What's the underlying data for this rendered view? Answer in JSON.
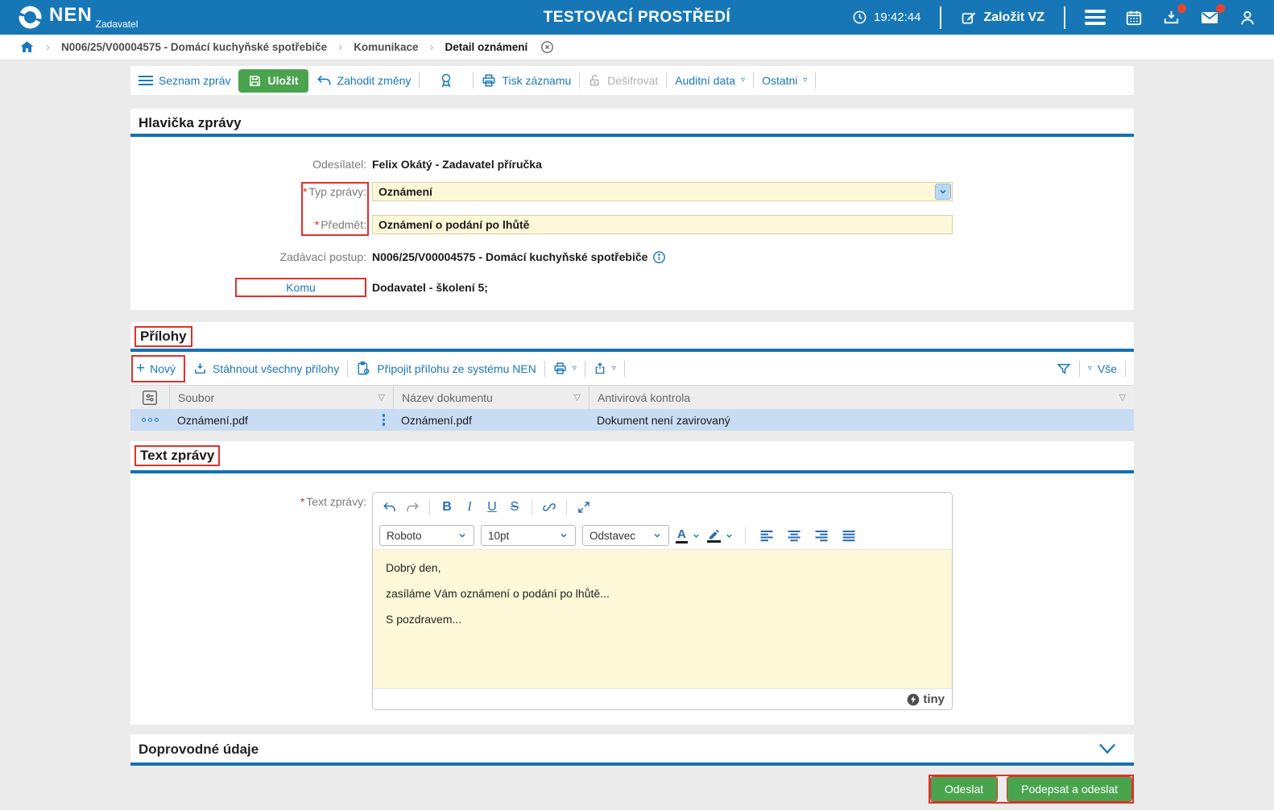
{
  "topbar": {
    "brand": "NEN",
    "brand_sub": "Zadavatel",
    "title": "TESTOVACÍ PROSTŘEDÍ",
    "time": "19:42:44",
    "create_vz": "Založit VZ"
  },
  "breadcrumb": {
    "item1": "N006/25/V00004575 - Domácí kuchyňské spotřebiče",
    "item2": "Komunikace",
    "item3": "Detail oznámení"
  },
  "toolbar": {
    "seznam": "Seznam zpráv",
    "ulozit": "Uložit",
    "zahodit": "Zahodit změny",
    "tisk": "Tisk záznamu",
    "desifrovat": "Dešifrovat",
    "auditni": "Auditní data",
    "ostatni": "Ostatni"
  },
  "required_marker": "*",
  "hlavicka": {
    "title": "Hlavička zprávy",
    "odesilatel_label": "Odesílatel:",
    "odesilatel_value": "Felix Okátý - Zadavatel příručka",
    "typ_label": "Typ zprávy:",
    "typ_value": "Oznámení",
    "predmet_label": "Předmět:",
    "predmet_value": "Oznámení o podání po lhůtě",
    "postup_label": "Zadávací postup:",
    "postup_value": "N006/25/V00004575 - Domácí kuchyňské spotřebiče",
    "komu_label": "Komu",
    "komu_value": "Dodavatel - školení 5;"
  },
  "prilohy": {
    "title": "Přílohy",
    "novy": "Nový",
    "stahnout": "Stáhnout všechny přílohy",
    "pripojit": "Připojit přílohu ze systému NEN",
    "vse": "Vše",
    "col_soubor": "Soubor",
    "col_nazev": "Název dokumentu",
    "col_antivir": "Antivirová kontrola",
    "rows": [
      {
        "soubor": "Oznámení.pdf",
        "nazev": "Oznámení.pdf",
        "antivir": "Dokument není zavirovaný"
      }
    ]
  },
  "text_zpravy": {
    "title": "Text zprávy",
    "label": "Text zprávy:",
    "font": "Roboto",
    "size": "10pt",
    "block": "Odstavec",
    "lines": [
      "Dobrý den,",
      "zasíláme Vám oznámení o podání po lhůtě...",
      "S pozdravem..."
    ],
    "brand": "tiny"
  },
  "doprovodne": {
    "title": "Doprovodné údaje"
  },
  "actions": {
    "odeslat": "Odeslat",
    "podepsat": "Podepsat a odeslat"
  },
  "colors": {
    "topbar_blue": "#1777b6",
    "link_blue": "#1878b9",
    "section_underline": "#1371b2",
    "button_green": "#4aa44e",
    "input_yellow": "#fdf8d7",
    "selected_row_blue": "#c8dcf3",
    "annotation_red": "#e03128",
    "notification_red": "#e8442e"
  }
}
